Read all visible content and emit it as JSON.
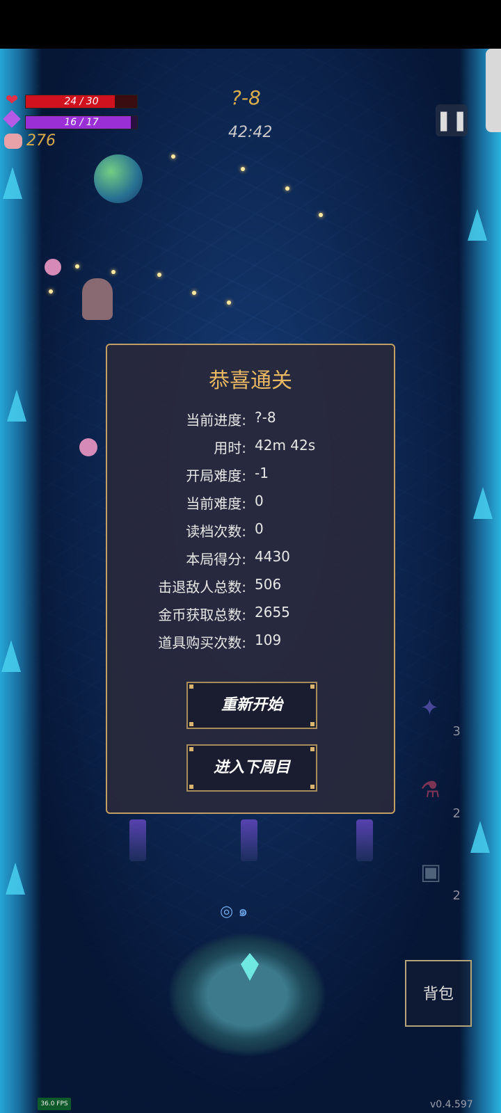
{
  "hud": {
    "health": {
      "text": "24 / 30",
      "current": 24,
      "max": 30,
      "color": "#d0121e"
    },
    "mana": {
      "text": "16 / 17",
      "current": 16,
      "max": 17,
      "color": "#9b2fd6"
    },
    "coins": "276",
    "stage": "?-8",
    "timer": "42:42",
    "pause_icon": "pause-icon"
  },
  "dialog": {
    "title": "恭喜通关",
    "stats": [
      {
        "label": "当前进度:",
        "value": "?-8"
      },
      {
        "label": "用时:",
        "value": "42m 42s"
      },
      {
        "label": "开局难度:",
        "value": "-1"
      },
      {
        "label": "当前难度:",
        "value": "0"
      },
      {
        "label": "读档次数:",
        "value": "0"
      },
      {
        "label": "本局得分:",
        "value": "4430"
      },
      {
        "label": "击退敌人总数:",
        "value": "506"
      },
      {
        "label": "金币获取总数:",
        "value": "2655"
      },
      {
        "label": "道具购买次数:",
        "value": "109"
      }
    ],
    "restart_label": "重新开始",
    "next_cycle_label": "进入下周目"
  },
  "shop": [
    {
      "icon": "shuriken-icon",
      "count": "3"
    },
    {
      "icon": "potion-icon",
      "count": "2"
    },
    {
      "icon": "crate-icon",
      "count": "2"
    }
  ],
  "bag_label": "背包",
  "fps": "36.0 FPS",
  "version": "v0.4.597",
  "colors": {
    "accent_gold": "#e8b862",
    "panel_border": "#c2a064"
  }
}
